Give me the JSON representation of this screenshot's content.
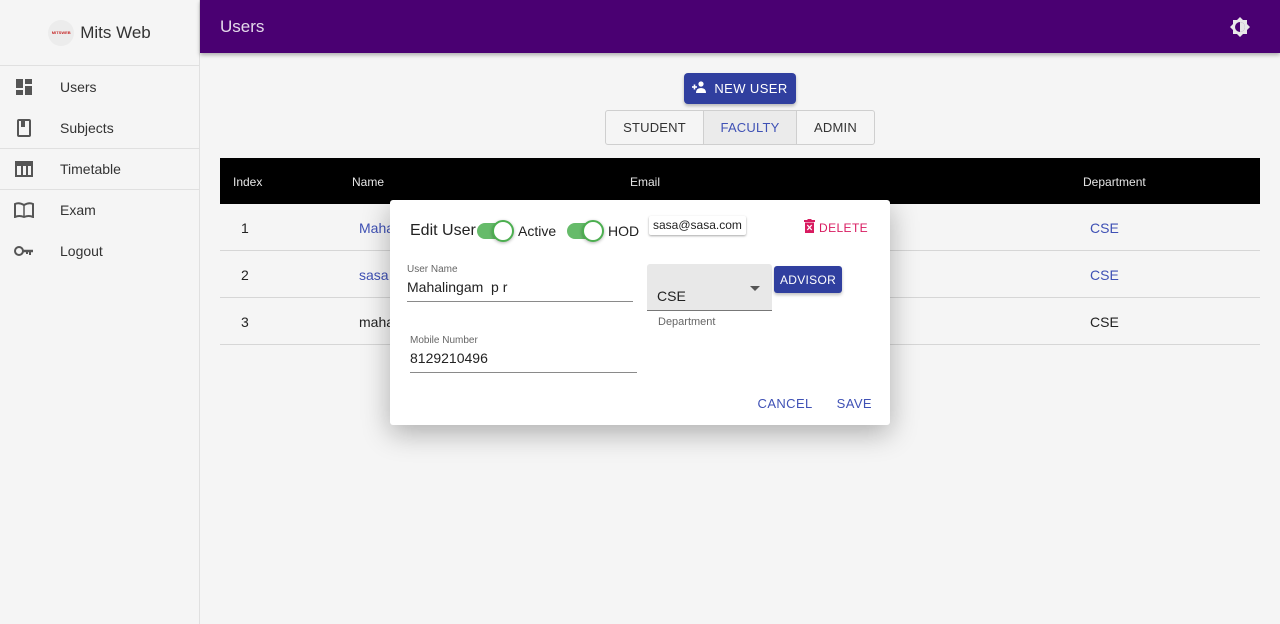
{
  "brand": {
    "name": "Mits Web",
    "logo_text": "MITSWEB"
  },
  "sidebar": {
    "items": [
      {
        "label": "Users",
        "icon": "dashboard-icon"
      },
      {
        "label": "Subjects",
        "icon": "book-icon"
      },
      {
        "label": "Timetable",
        "icon": "table-icon"
      },
      {
        "label": "Exam",
        "icon": "open-book-icon"
      },
      {
        "label": "Logout",
        "icon": "key-icon"
      }
    ]
  },
  "appbar": {
    "title": "Users",
    "theme_icon": "brightness-icon",
    "color": "#4a0072"
  },
  "actions": {
    "new_user": "NEW USER"
  },
  "tabs": [
    {
      "label": "STUDENT",
      "selected": false
    },
    {
      "label": "FACULTY",
      "selected": true
    },
    {
      "label": "ADMIN",
      "selected": false
    }
  ],
  "table": {
    "headers": {
      "index": "Index",
      "name": "Name",
      "email": "Email",
      "department": "Department"
    },
    "rows": [
      {
        "index": "1",
        "name": "Maha",
        "department": "CSE"
      },
      {
        "index": "2",
        "name": "sasa",
        "department": "CSE"
      },
      {
        "index": "3",
        "name": "maha",
        "department": "CSE"
      }
    ]
  },
  "dialog": {
    "title": "Edit User",
    "active_label": "Active",
    "active_on": true,
    "hod_label": "HOD",
    "hod_on": true,
    "email": "sasa@sasa.com",
    "delete_label": "DELETE",
    "username_label": "User Name",
    "username_value": "Mahalingam  p r",
    "department_value": "CSE",
    "department_helper": "Department",
    "advisor_label": "ADVISOR",
    "mobile_label": "Mobile Number",
    "mobile_value": "8129210496",
    "cancel_label": "CANCEL",
    "save_label": "SAVE"
  },
  "colors": {
    "primary": "#303f9f",
    "accent_link": "#3f51b5",
    "danger": "#d81b60",
    "switch_on": "#4caf50"
  }
}
